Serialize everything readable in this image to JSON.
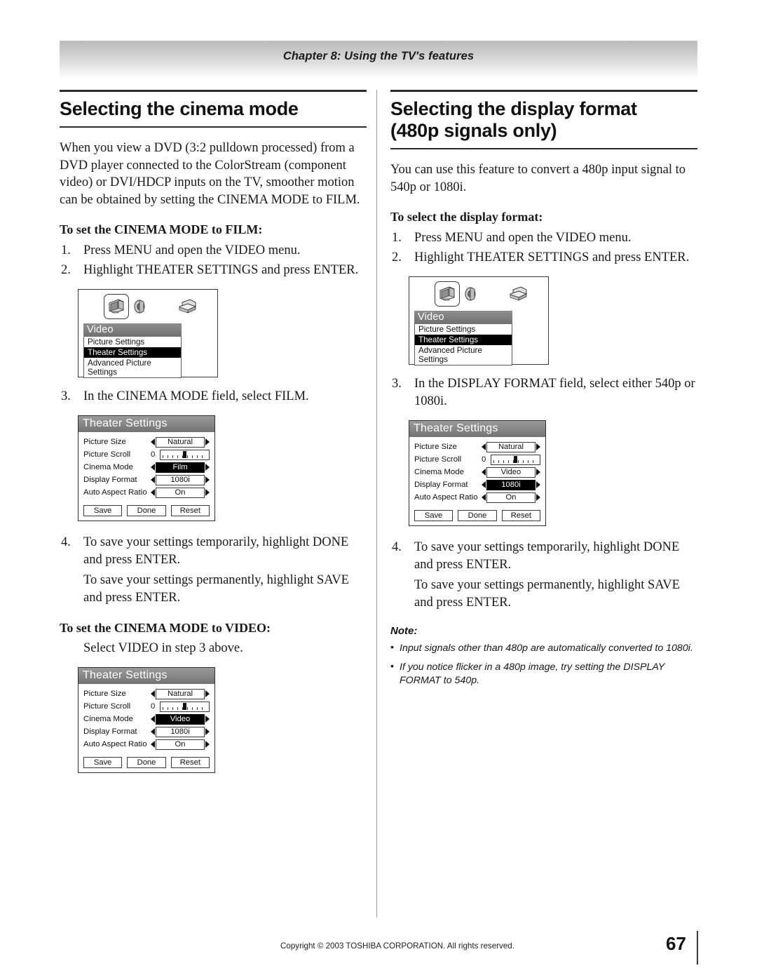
{
  "header": {
    "chapter": "Chapter 8: Using the TV's features"
  },
  "left": {
    "title": "Selecting the cinema mode",
    "intro": "When you view a DVD (3:2 pulldown processed) from a DVD player connected to the ColorStream (component video) or DVI/HDCP inputs on the TV, smoother motion can be obtained by setting the CINEMA MODE to FILM.",
    "sub1": "To set the CINEMA MODE to FILM:",
    "steps": [
      {
        "num": "1.",
        "text": "Press MENU and open the VIDEO menu."
      },
      {
        "num": "2.",
        "text": "Highlight THEATER SETTINGS and press ENTER."
      }
    ],
    "step3": {
      "num": "3.",
      "text": "In the CINEMA MODE field, select FILM."
    },
    "step4": {
      "num": "4.",
      "text": "To save your settings temporarily, highlight DONE and press ENTER."
    },
    "step4b": "To save your settings permanently, highlight SAVE and press ENTER.",
    "sub2": "To set the CINEMA MODE to VIDEO:",
    "sub2_text": "Select VIDEO in step 3 above."
  },
  "right": {
    "title_line1": "Selecting the display format",
    "title_line2": "(480p signals only)",
    "intro": "You can use this feature to convert a 480p input signal to 540p or 1080i.",
    "sub1": "To select the display format:",
    "steps": [
      {
        "num": "1.",
        "text": "Press MENU and open the VIDEO menu."
      },
      {
        "num": "2.",
        "text": "Highlight THEATER SETTINGS and press ENTER."
      }
    ],
    "step3": {
      "num": "3.",
      "text": "In the DISPLAY FORMAT field, select either 540p or 1080i."
    },
    "step4": {
      "num": "4.",
      "text": "To save your settings temporarily, highlight DONE and press ENTER."
    },
    "step4b": "To save your settings permanently, highlight SAVE and press ENTER.",
    "note_title": "Note:",
    "notes": [
      "Input signals other than 480p are automatically converted to 1080i.",
      "If you notice flicker in a 480p image, try setting the DISPLAY FORMAT to 540p."
    ]
  },
  "osd_video_menu": {
    "icons": [
      "tv-icon",
      "speaker-icon",
      "setup-icon"
    ],
    "header": "Video",
    "items": [
      {
        "label": "Picture Settings",
        "selected": false
      },
      {
        "label": "Theater Settings",
        "selected": true
      },
      {
        "label": "Advanced Picture Settings",
        "selected": false
      }
    ]
  },
  "osd_theater_film": {
    "header": "Theater Settings",
    "rows": [
      {
        "label": "Picture Size",
        "value": "Natural",
        "type": "select",
        "highlighted": false
      },
      {
        "label": "Picture Scroll",
        "value": "0",
        "type": "slider",
        "highlighted": false
      },
      {
        "label": "Cinema Mode",
        "value": "Film",
        "type": "select",
        "highlighted": true
      },
      {
        "label": "Display Format",
        "value": "1080i",
        "type": "select",
        "highlighted": false
      },
      {
        "label": "Auto Aspect Ratio",
        "value": "On",
        "type": "select",
        "highlighted": false
      }
    ],
    "buttons": [
      "Save",
      "Done",
      "Reset"
    ]
  },
  "osd_theater_video": {
    "header": "Theater Settings",
    "rows": [
      {
        "label": "Picture Size",
        "value": "Natural",
        "type": "select",
        "highlighted": false
      },
      {
        "label": "Picture Scroll",
        "value": "0",
        "type": "slider",
        "highlighted": false
      },
      {
        "label": "Cinema Mode",
        "value": "Video",
        "type": "select",
        "highlighted": true
      },
      {
        "label": "Display Format",
        "value": "1080i",
        "type": "select",
        "highlighted": false
      },
      {
        "label": "Auto Aspect Ratio",
        "value": "On",
        "type": "select",
        "highlighted": false
      }
    ],
    "buttons": [
      "Save",
      "Done",
      "Reset"
    ]
  },
  "osd_theater_format": {
    "header": "Theater Settings",
    "rows": [
      {
        "label": "Picture Size",
        "value": "Natural",
        "type": "select",
        "highlighted": false
      },
      {
        "label": "Picture Scroll",
        "value": "0",
        "type": "slider",
        "highlighted": false
      },
      {
        "label": "Cinema Mode",
        "value": "Video",
        "type": "select",
        "highlighted": false
      },
      {
        "label": "Display Format",
        "value": "1080i",
        "type": "select",
        "highlighted": true
      },
      {
        "label": "Auto Aspect Ratio",
        "value": "On",
        "type": "select",
        "highlighted": false
      }
    ],
    "buttons": [
      "Save",
      "Done",
      "Reset"
    ]
  },
  "footer": {
    "copyright": "Copyright © 2003 TOSHIBA CORPORATION. All rights reserved.",
    "page": "67"
  }
}
